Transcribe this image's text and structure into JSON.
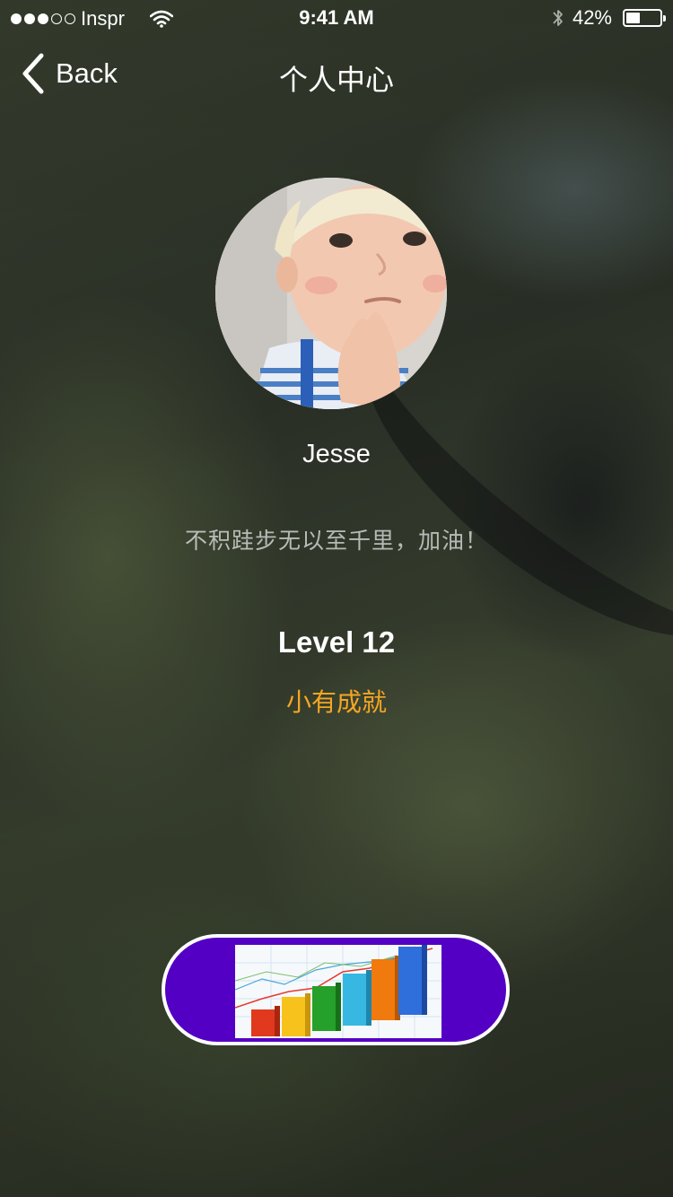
{
  "status_bar": {
    "carrier": "Inspr",
    "time": "9:41 AM",
    "battery": "42%",
    "battery_level": 0.42,
    "signal_bars": 3,
    "signal_total": 5
  },
  "nav": {
    "back_label": "Back",
    "title": "个人中心"
  },
  "profile": {
    "name": "Jesse",
    "motto": "不积跬步无以至千里，加油！",
    "level": "Level 12",
    "level_title": "小有成就"
  },
  "colors": {
    "accent_orange": "#f5a623",
    "button_purple": "#5400c4"
  },
  "icons": {
    "back": "chevron-left-icon",
    "wifi": "wifi-icon",
    "bluetooth": "bluetooth-icon",
    "battery": "battery-icon",
    "stats": "bar-chart-icon"
  }
}
